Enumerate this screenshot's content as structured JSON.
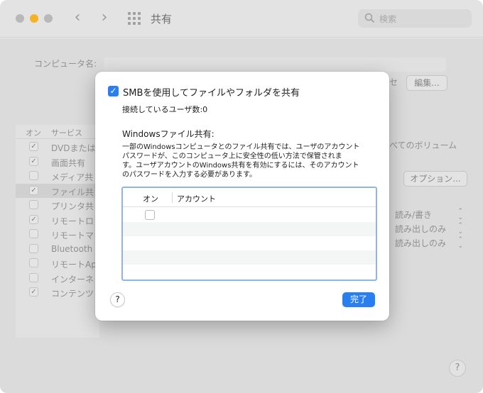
{
  "window": {
    "title": "共有",
    "search_placeholder": "検索",
    "accent_color": "#2a7ff0"
  },
  "background": {
    "computer_name_label": "コンピュータ名:",
    "edit_button": "編集...",
    "edit_prefix_fragment": "セ",
    "options_button": "オプション...",
    "volumes_fragment": "べてのボリューム",
    "services_header_on": "オン",
    "services_header_service": "サービス",
    "services": [
      {
        "label": "DVDまたは",
        "checked": true
      },
      {
        "label": "画面共有",
        "checked": true
      },
      {
        "label": "メディア共",
        "checked": false
      },
      {
        "label": "ファイル共",
        "checked": true,
        "selected": true
      },
      {
        "label": "プリンタ共",
        "checked": false
      },
      {
        "label": "リモートロ",
        "checked": true
      },
      {
        "label": "リモートマ",
        "checked": false
      },
      {
        "label": "Bluetooth",
        "checked": false
      },
      {
        "label": "リモートAp",
        "checked": false
      },
      {
        "label": "インターネ",
        "checked": false
      },
      {
        "label": "コンテンツ",
        "checked": true
      }
    ],
    "permissions": [
      "読み/書き",
      "読み出しのみ",
      "読み出しのみ"
    ],
    "help_label": "?"
  },
  "sheet": {
    "smb_label": "SMBを使用してファイルやフォルダを共有",
    "smb_checked": true,
    "connected_users": "接続しているユーザ数:0",
    "windows_title": "Windowsファイル共有:",
    "windows_desc": [
      "一部のWindowsコンピュータとのファイル共有では、ユーザのアカウント",
      "パスワードが、このコンピュータ上に安全性の低い方法で保管されま",
      "す。ユーザアカウントのWindows共有を有効にするには、そのアカウント",
      "のパスワードを入力する必要があります。"
    ],
    "table": {
      "col_on": "オン",
      "col_account": "アカウント",
      "rows": [
        {
          "checked": false,
          "account": ""
        }
      ]
    },
    "help_label": "?",
    "done_label": "完了"
  }
}
